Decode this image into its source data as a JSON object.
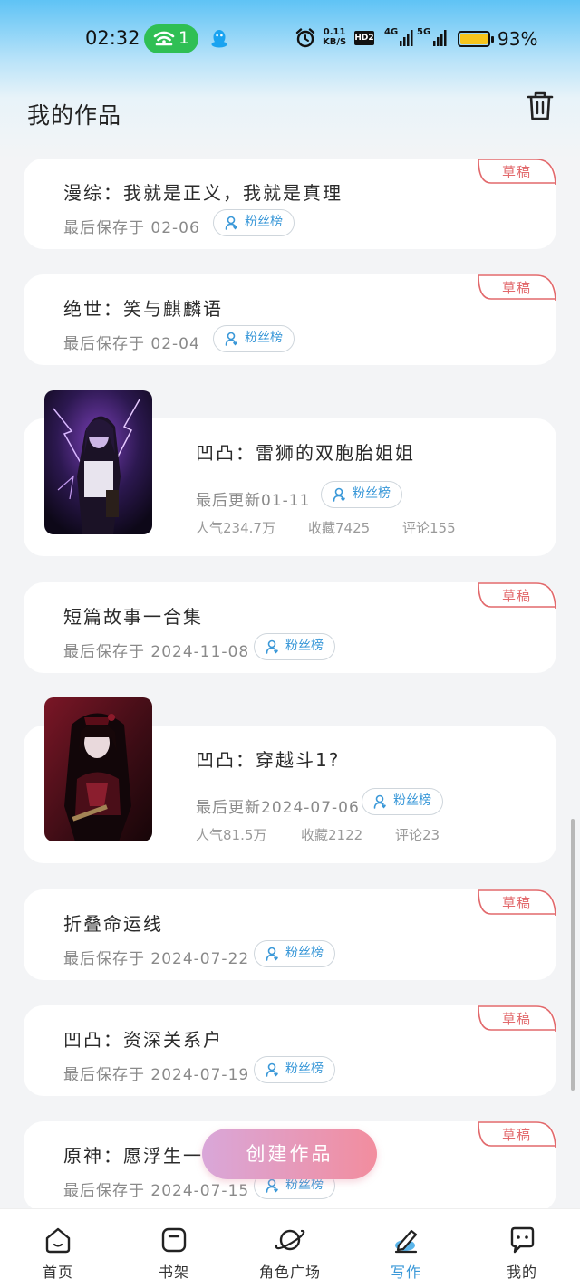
{
  "status_bar": {
    "time": "02:32",
    "wifi_count": "1",
    "speed_value": "0.11",
    "speed_unit": "KB/S",
    "hd_label": "HD2",
    "net1": "4G",
    "net2": "5G",
    "battery": "93%",
    "battery_level": 0.93
  },
  "header": {
    "title": "我的作品"
  },
  "badge_label": "草稿",
  "fan_label": "粉丝榜",
  "works": [
    {
      "title": "漫综：我就是正义，我就是真理",
      "meta": "最后保存于 02-06",
      "draft": true
    },
    {
      "title": "绝世：笑与麒麟语",
      "meta": "最后保存于 02-04",
      "draft": true
    },
    {
      "title": "凹凸：雷狮的双胞胎姐姐",
      "meta": "最后更新01-11",
      "popularity": "人气234.7万",
      "favorites": "收藏7425",
      "comments": "评论155",
      "draft": false
    },
    {
      "title": "短篇故事一合集",
      "meta": "最后保存于 2024-11-08",
      "draft": true
    },
    {
      "title": "凹凸：穿越斗1?",
      "meta": "最后更新2024-07-06",
      "popularity": "人气81.5万",
      "favorites": "收藏2122",
      "comments": "评论23",
      "draft": false
    },
    {
      "title": "折叠命运线",
      "meta": "最后保存于 2024-07-22",
      "draft": true
    },
    {
      "title": "凹凸：资深关系户",
      "meta": "最后保存于 2024-07-19",
      "draft": true
    },
    {
      "title": "原神：愿浮生一",
      "meta": "最后保存于 2024-07-15",
      "draft": true
    }
  ],
  "create_button": "创建作品",
  "nav": {
    "home": "首页",
    "bookshelf": "书架",
    "plaza": "角色广场",
    "write": "写作",
    "mine": "我的"
  },
  "colors": {
    "accent": "#3a98d8",
    "draft": "#e2696c",
    "wifi_pill": "#2fbf54",
    "create_start": "#d9a7d9",
    "create_end": "#f28d9e"
  }
}
